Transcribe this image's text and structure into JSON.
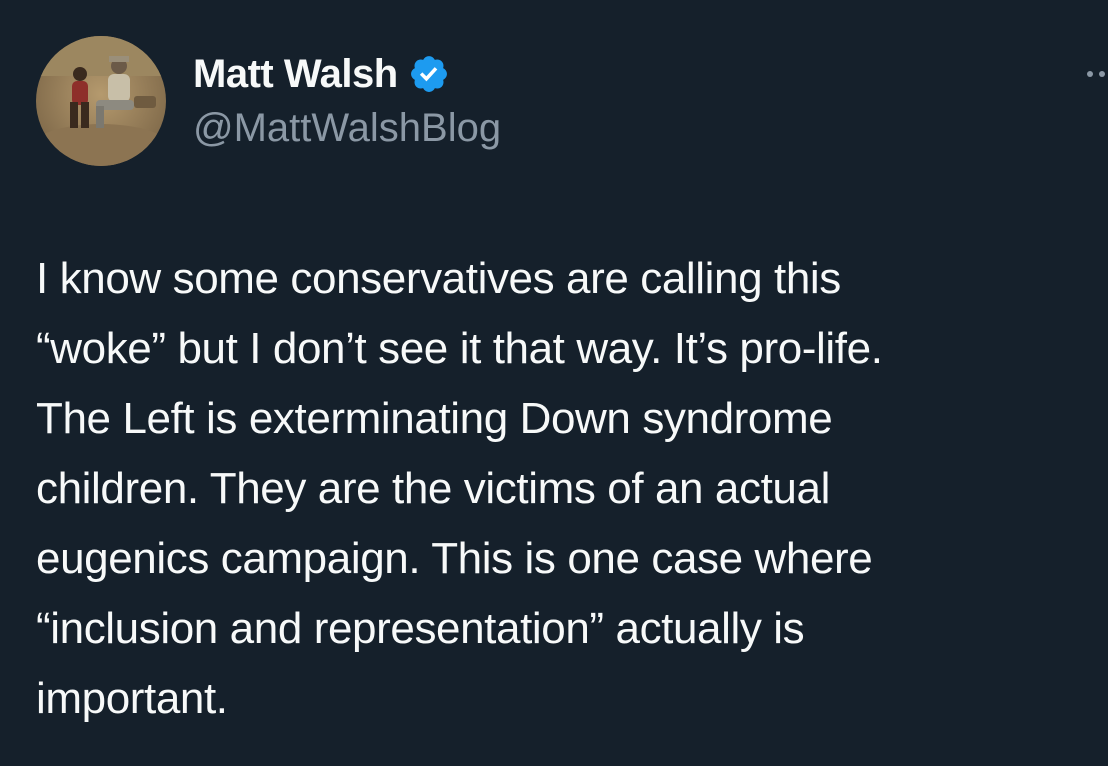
{
  "author": {
    "display_name": "Matt Walsh",
    "handle": "@MattWalshBlog",
    "verified": true,
    "verified_color": "#1d9bf0"
  },
  "tweet": {
    "lines": [
      "I know some conservatives are calling this",
      "“woke” but I don’t see it that way. It’s pro-life.",
      "The Left is exterminating Down syndrome",
      "children. They are the victims of an actual",
      "eugenics campaign. This is one case where",
      "“inclusion and representation” actually is",
      "important."
    ]
  },
  "colors": {
    "background": "#15202b",
    "text": "#f7f9f9",
    "secondary_text": "#8b98a5"
  },
  "icons": {
    "more": "more-options-icon",
    "verified": "verified-badge-icon"
  }
}
